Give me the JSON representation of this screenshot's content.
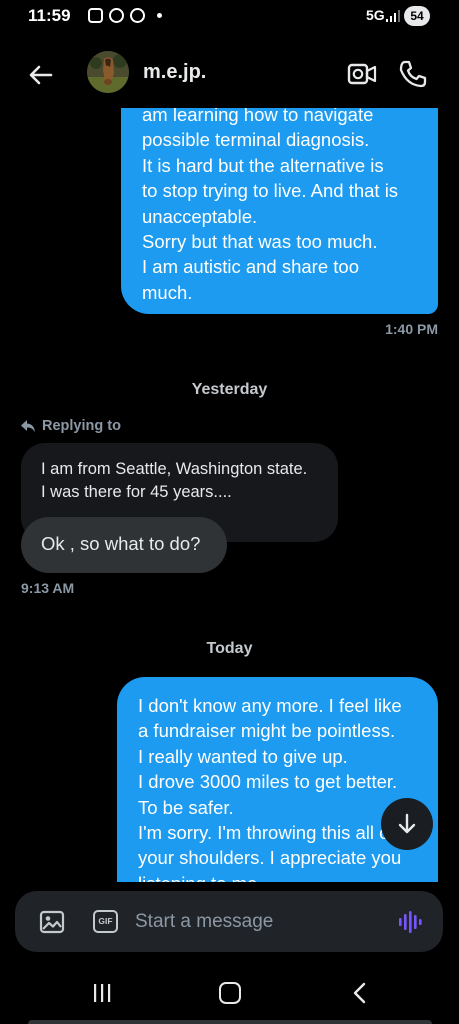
{
  "status_bar": {
    "time": "11:59",
    "network": "5G",
    "battery": "54"
  },
  "header": {
    "contact_name": "m.e.jp."
  },
  "messages": {
    "outgoing_1": {
      "lines": [
        "am learning how to navigate",
        "possible terminal diagnosis.",
        "It is hard but the alternative is",
        "to stop trying to live. And that is",
        "unacceptable.",
        "Sorry but that was too much.",
        "I am autistic and share too",
        "much."
      ],
      "time": "1:40 PM"
    },
    "day_yesterday": "Yesterday",
    "replying_label": "Replying to",
    "quoted": {
      "lines": [
        "I am from Seattle, Washington state.",
        "I was there for 45 years...."
      ]
    },
    "incoming_1": {
      "text": "Ok , so what to do?",
      "time": "9:13 AM"
    },
    "day_today": "Today",
    "outgoing_2": {
      "lines": [
        "I don't know any more. I feel like",
        "a fundraiser might be pointless.",
        "I really wanted to give up.",
        "I drove 3000 miles to get better.",
        "To be safer.",
        "I'm sorry. I'm throwing this all on",
        "your shoulders. I appreciate you",
        "listening to me."
      ]
    }
  },
  "composer": {
    "placeholder": "Start a message",
    "gif_label": "GIF"
  },
  "colors": {
    "accent": "#1d9bf0",
    "voice": "#7856ff"
  },
  "icons": {
    "back": "arrow-left-icon",
    "video": "video-camera-icon",
    "call": "phone-icon",
    "reply": "reply-arrow-icon",
    "scroll": "arrow-down-icon",
    "image": "image-icon",
    "gif": "gif-icon",
    "voice": "voice-waveform-icon"
  }
}
